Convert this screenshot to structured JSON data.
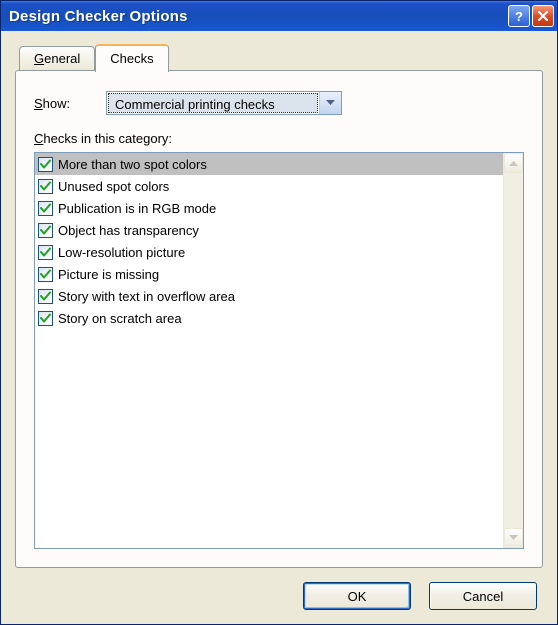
{
  "window": {
    "title": "Design Checker Options"
  },
  "tabs": {
    "general": "General",
    "checks": "Checks"
  },
  "show": {
    "label_pre": "S",
    "label_post": "how:",
    "selected": "Commercial printing checks"
  },
  "category": {
    "label_pre": "C",
    "label_post": "hecks in this category:"
  },
  "checks": [
    {
      "label": "More than two spot colors",
      "checked": true,
      "selected": true
    },
    {
      "label": "Unused spot colors",
      "checked": true,
      "selected": false
    },
    {
      "label": "Publication is in RGB mode",
      "checked": true,
      "selected": false
    },
    {
      "label": "Object has transparency",
      "checked": true,
      "selected": false
    },
    {
      "label": "Low-resolution picture",
      "checked": true,
      "selected": false
    },
    {
      "label": "Picture is missing",
      "checked": true,
      "selected": false
    },
    {
      "label": "Story with text in overflow area",
      "checked": true,
      "selected": false
    },
    {
      "label": "Story on scratch area",
      "checked": true,
      "selected": false
    }
  ],
  "buttons": {
    "ok": "OK",
    "cancel": "Cancel"
  }
}
